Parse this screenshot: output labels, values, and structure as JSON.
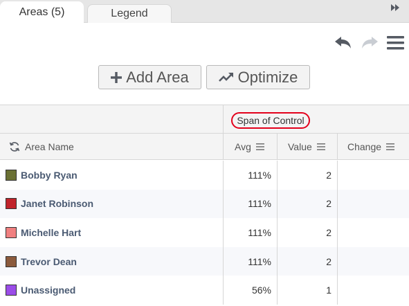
{
  "tabs": [
    {
      "label": "Areas (5)",
      "active": true
    },
    {
      "label": "Legend",
      "active": false
    }
  ],
  "toolbar": {
    "undo_icon": "undo-icon",
    "redo_icon": "redo-icon",
    "menu_icon": "hamburger-menu-icon"
  },
  "actions": {
    "add_area_label": "Add Area",
    "optimize_label": "Optimize"
  },
  "table": {
    "group_header": "Span of Control",
    "columns": {
      "name": "Area Name",
      "avg": "Avg",
      "value": "Value",
      "change": "Change"
    },
    "rows": [
      {
        "name": "Bobby Ryan",
        "color": "#6b7134",
        "avg": "111%",
        "value": "2",
        "change": ""
      },
      {
        "name": "Janet Robinson",
        "color": "#c0232b",
        "avg": "111%",
        "value": "2",
        "change": ""
      },
      {
        "name": "Michelle Hart",
        "color": "#f08080",
        "avg": "111%",
        "value": "2",
        "change": ""
      },
      {
        "name": "Trevor Dean",
        "color": "#8b5a3c",
        "avg": "111%",
        "value": "2",
        "change": ""
      },
      {
        "name": "Unassigned",
        "color": "#9b4de8",
        "avg": "56%",
        "value": "1",
        "change": ""
      }
    ]
  },
  "colors": {
    "highlight_ring": "#e3001b",
    "icon_gray": "#555a63"
  }
}
